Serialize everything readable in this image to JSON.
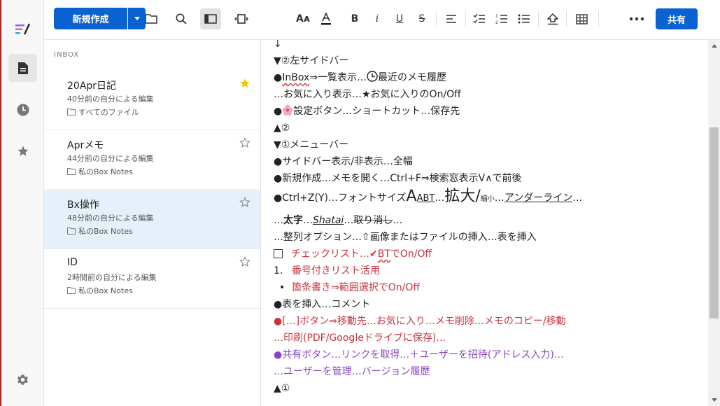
{
  "toolbar": {
    "new_label": "新規作成",
    "share_label": "共有"
  },
  "sidebar": {
    "section_title": "INBOX",
    "notes": [
      {
        "title": "20Apr日記",
        "subtitle": "40分前の自分による編集",
        "folder": "すべてのファイル",
        "starred": true
      },
      {
        "title": "Aprメモ",
        "subtitle": "44分前の自分による編集",
        "folder": "私のBox Notes",
        "starred": false
      },
      {
        "title": "Bx操作",
        "subtitle": "48分前の自分による編集",
        "folder": "私のBox Notes",
        "starred": false
      },
      {
        "title": "ID",
        "subtitle": "2時間前の自分による編集",
        "folder": "私のBox Notes",
        "starred": false
      }
    ]
  },
  "editor": {
    "l0": "↓",
    "l1": "▼②左サイドバー",
    "l2a": "●",
    "l2b": "InBox",
    "l2c": "⇒一覧表示…",
    "l2d": "最近のメモ履歴",
    "l3": "…お気に入り表示…★お気に入りのOn/Off",
    "l4a": "●",
    "l4b": "設定ボタン…ショートカット…保存先",
    "l5": "▲②",
    "l6": "▼①メニューバー",
    "l7": "●サイドバー表示/非表示…全幅",
    "l8": "●新規作成…メモを開く…Ctrl+F⇒検索窓表示V∧で前後",
    "l9a": "●Ctrl+Z(Y)…フォントサイズ",
    "l9b": "A",
    "l9c": "ABT",
    "l9d": "…",
    "l9e": "拡大/",
    "l9f": "縮小",
    "l9g": "…",
    "l9h": "アンダーライン",
    "l9i": "…",
    "l10a": "…",
    "l10b": "太字",
    "l10c": "…",
    "l10d": "Shatai",
    "l10e": "…",
    "l10f": "取り消し",
    "l10g": "…",
    "l11": "…整列オプション…⇧画像またはファイルの挿入…表を挿入",
    "l12a": "チェックリスト…✔",
    "l12b": "BT",
    "l12c": "でOn/Off",
    "l13num": "1.",
    "l13": "番号付きリスト活用",
    "l14bullet": "•",
    "l14": "箇条書き⇒範囲選択でOn/Off",
    "l15": "●表を挿入…コメント",
    "l16": "●[…]ボタン⇒移動先…お気に入り…メモ削除…メモのコピー/移動",
    "l17": "…印刷(PDF/Googleドライブに保存)…",
    "l18": "●共有ボタン…リンクを取得…＋ユーザーを招待(アドレス入力)…",
    "l19": "…ユーザーを管理…バージョン履歴",
    "l20": "▲①"
  },
  "colors": {
    "accent": "#0a61d1",
    "star_active": "#f5c400",
    "red_text": "#c83340",
    "purple_text": "#8b45c4",
    "selected_row": "#e6f0fa"
  }
}
